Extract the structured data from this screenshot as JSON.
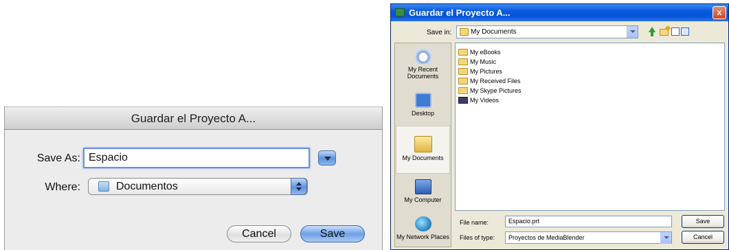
{
  "mac_dialog": {
    "title": "Guardar el Proyecto A...",
    "save_as_label": "Save As:",
    "save_as_value": "Espacio",
    "where_label": "Where:",
    "where_value": "Documentos",
    "cancel_label": "Cancel",
    "save_label": "Save"
  },
  "win_dialog": {
    "title": "Guardar el Proyecto A...",
    "close_glyph": "x",
    "save_in_label": "Save in:",
    "save_in_value": "My Documents",
    "places": [
      {
        "label": "My Recent Documents",
        "icon": "recent-documents-icon"
      },
      {
        "label": "Desktop",
        "icon": "desktop-icon"
      },
      {
        "label": "My Documents",
        "icon": "my-documents-icon",
        "selected": true
      },
      {
        "label": "My Computer",
        "icon": "my-computer-icon"
      },
      {
        "label": "My Network Places",
        "icon": "network-places-icon"
      }
    ],
    "files": [
      {
        "name": "My eBooks",
        "icon": "folder-icon"
      },
      {
        "name": "My Music",
        "icon": "folder-icon"
      },
      {
        "name": "My Pictures",
        "icon": "folder-icon"
      },
      {
        "name": "My Received Files",
        "icon": "folder-icon"
      },
      {
        "name": "My Skype Pictures",
        "icon": "folder-icon"
      },
      {
        "name": "My Videos",
        "icon": "video-folder-icon"
      }
    ],
    "file_name_label": "File name:",
    "file_name_value": "Espacio.prt",
    "files_of_type_label": "Files of type:",
    "files_of_type_value": "Proyectos de MediaBlender",
    "save_label": "Save",
    "cancel_label": "Cancel"
  }
}
